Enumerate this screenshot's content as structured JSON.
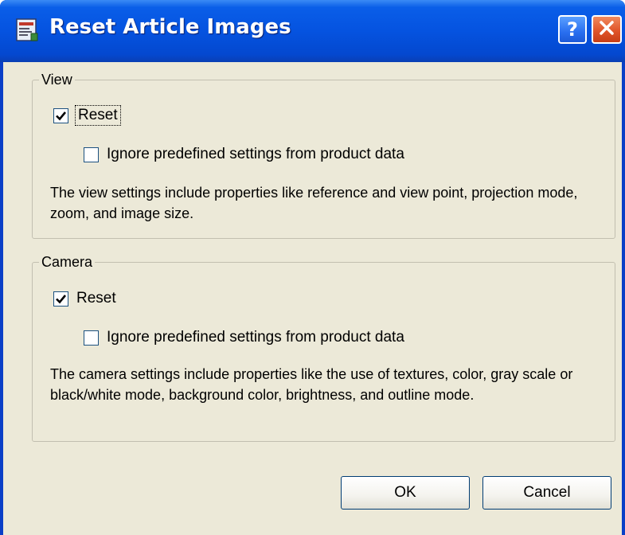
{
  "window": {
    "title": "Reset Article Images",
    "help_glyph": "?",
    "close_icon": "close-icon",
    "app_icon": "document-icon"
  },
  "view_group": {
    "legend": "View",
    "reset_label": "Reset",
    "reset_checked": true,
    "ignore_label": "Ignore predefined settings from product data",
    "ignore_checked": false,
    "description": "The view settings include properties like reference and view point, projection mode, zoom, and image size."
  },
  "camera_group": {
    "legend": "Camera",
    "reset_label": "Reset",
    "reset_checked": true,
    "ignore_label": "Ignore predefined settings from product data",
    "ignore_checked": false,
    "description": "The camera settings include properties like the use of textures, color, gray scale or black/white mode, background color, brightness, and outline mode."
  },
  "buttons": {
    "ok_label": "OK",
    "cancel_label": "Cancel"
  },
  "colors": {
    "titlebar": "#0553e0",
    "client_bg": "#ece9d8",
    "close_button": "#e0552a"
  }
}
